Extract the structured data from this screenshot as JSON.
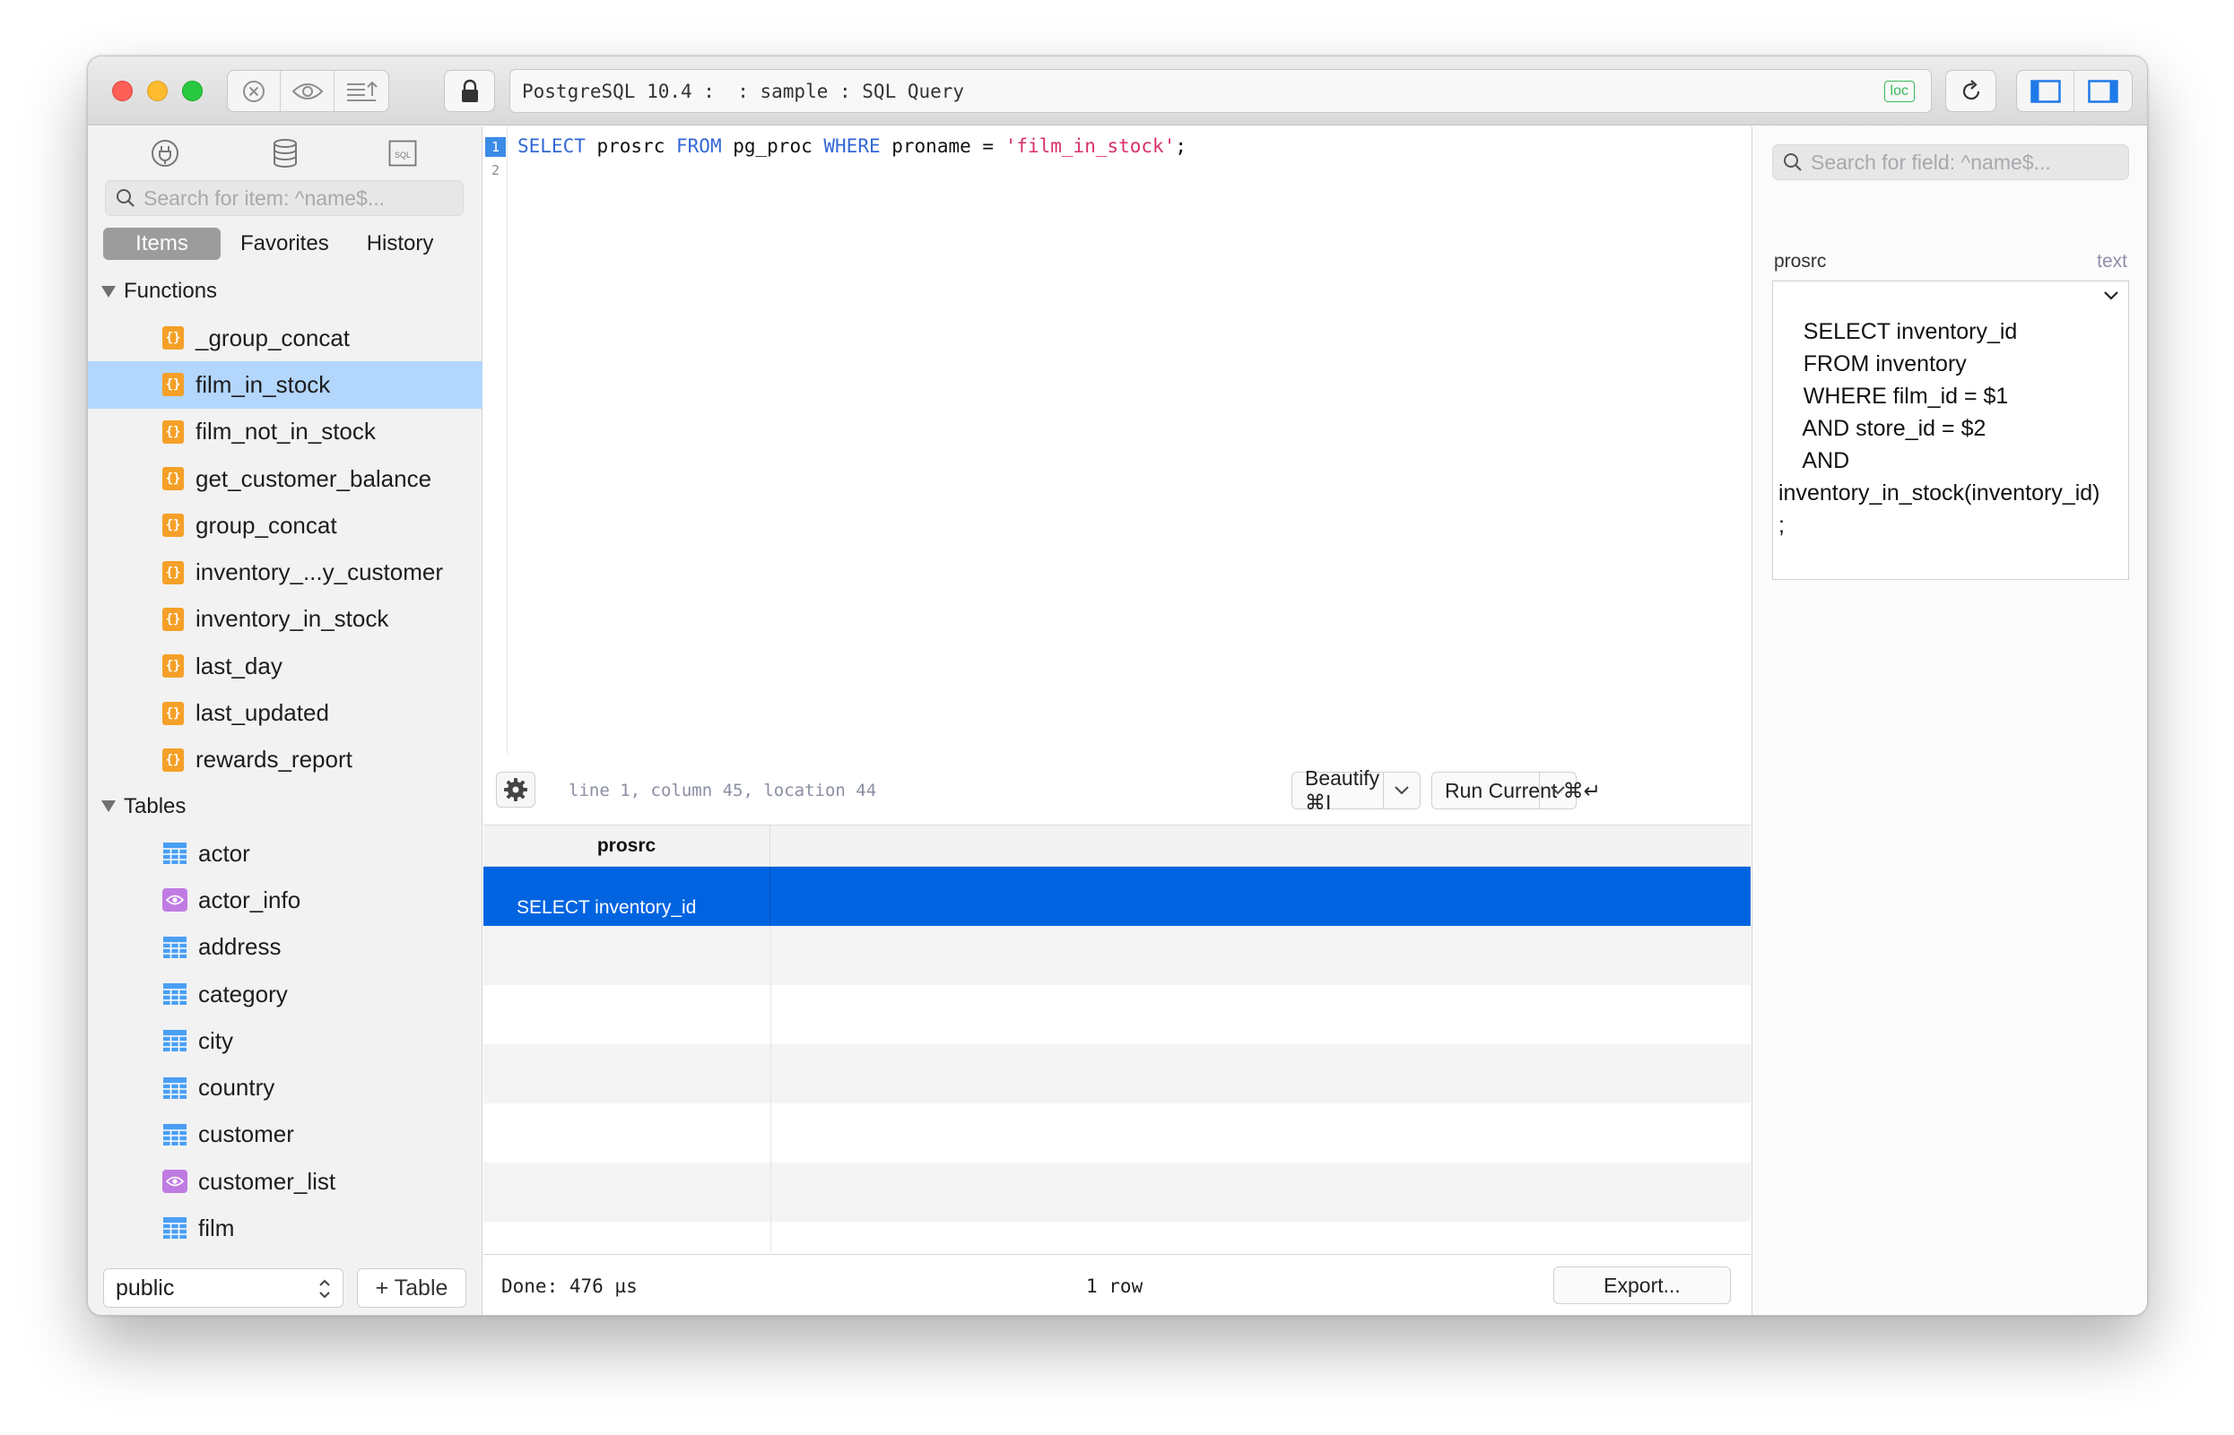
{
  "toolbar": {
    "address_text": "PostgreSQL 10.4 :  : sample : SQL Query",
    "loc_badge": "loc"
  },
  "sidebar": {
    "search_placeholder": "Search for item: ^name$...",
    "tabs": [
      "Items",
      "Favorites",
      "History"
    ],
    "groups": {
      "functions": {
        "label": "Functions",
        "items": [
          "_group_concat",
          "film_in_stock",
          "film_not_in_stock",
          "get_customer_balance",
          "group_concat",
          "inventory_...y_customer",
          "inventory_in_stock",
          "last_day",
          "last_updated",
          "rewards_report"
        ]
      },
      "tables": {
        "label": "Tables",
        "items": [
          "actor",
          "actor_info",
          "address",
          "category",
          "city",
          "country",
          "customer",
          "customer_list",
          "film"
        ]
      }
    },
    "schema_value": "public",
    "add_table_label": "+ Table"
  },
  "editor": {
    "line_numbers": [
      "1",
      "2"
    ],
    "code": {
      "kw_select": "SELECT",
      "col": " prosrc ",
      "kw_from": "FROM",
      "table": " pg_proc ",
      "kw_where": "WHERE",
      "cond": " proname = ",
      "str": "'film_in_stock'",
      "end": ";"
    },
    "cursor_info": "line 1, column 45, location 44",
    "beautify_label": "Beautify ⌘I",
    "run_label": "Run Current ⌘↵"
  },
  "results": {
    "column": "prosrc",
    "selected_row_value": "SELECT inventory_id",
    "done_text": "Done: 476 µs",
    "row_count": "1 row",
    "export_label": "Export..."
  },
  "detail": {
    "search_placeholder": "Search for field: ^name$...",
    "field_name": "prosrc",
    "field_type": "text",
    "value_lines": [
      "    SELECT inventory_id",
      "    FROM inventory",
      "    WHERE film_id = $1",
      "    AND store_id = $2",
      "    AND",
      "inventory_in_stock(inventory_id)",
      ";"
    ]
  },
  "colors": {
    "selection_blue": "#0064e1",
    "sidebar_selection": "#b3d6fc",
    "function_icon": "#f5a028",
    "table_icon": "#4a9ff5",
    "view_icon": "#c07be3",
    "keyword": "#3367d6",
    "string": "#d8306a"
  }
}
